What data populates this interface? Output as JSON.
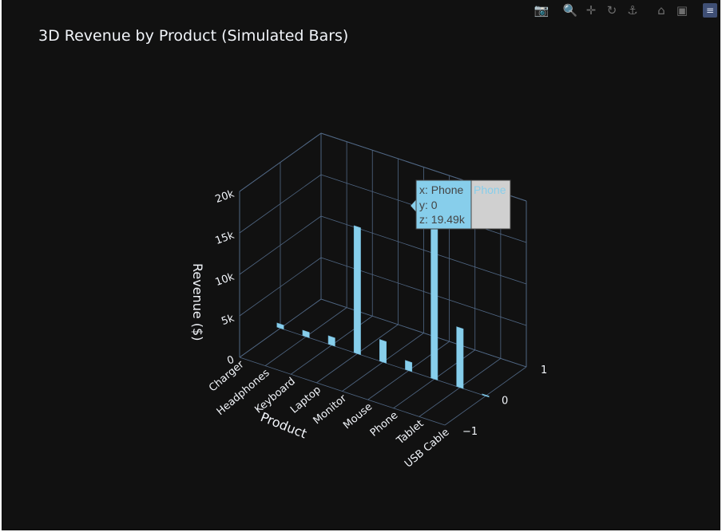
{
  "title": "3D Revenue by Product (Simulated Bars)",
  "modebar": {
    "icons": [
      "camera-icon",
      "zoom-icon",
      "pan-icon",
      "orbit-icon",
      "turntable-icon",
      "home-icon",
      "camera-views-icon",
      "plotly-logo-icon"
    ]
  },
  "colors": {
    "background": "#111111",
    "bar": "#87ceeb",
    "grid": "#506784",
    "text": "#f2f5fa"
  },
  "chart_data": {
    "type": "bar",
    "subtype": "3d-bar",
    "title": "3D Revenue by Product (Simulated Bars)",
    "xlabel": "Product",
    "ylabel": "",
    "zlabel": "Revenue ($)",
    "categories": [
      "Charger",
      "Headphones",
      "Keyboard",
      "Laptop",
      "Monitor",
      "Mouse",
      "Phone",
      "Tablet",
      "USB Cable"
    ],
    "values": [
      500,
      650,
      1000,
      15300,
      2600,
      1100,
      19490,
      7200,
      120
    ],
    "y_ticks": [
      "−1",
      "0",
      "1"
    ],
    "z_ticks": [
      "0",
      "5k",
      "10k",
      "15k",
      "20k"
    ],
    "zlim": [
      0,
      20000
    ],
    "hover": {
      "x_line": "x: Phone",
      "y_line": "y: 0",
      "z_line": "z: 19.49k",
      "name": "Phone"
    }
  }
}
